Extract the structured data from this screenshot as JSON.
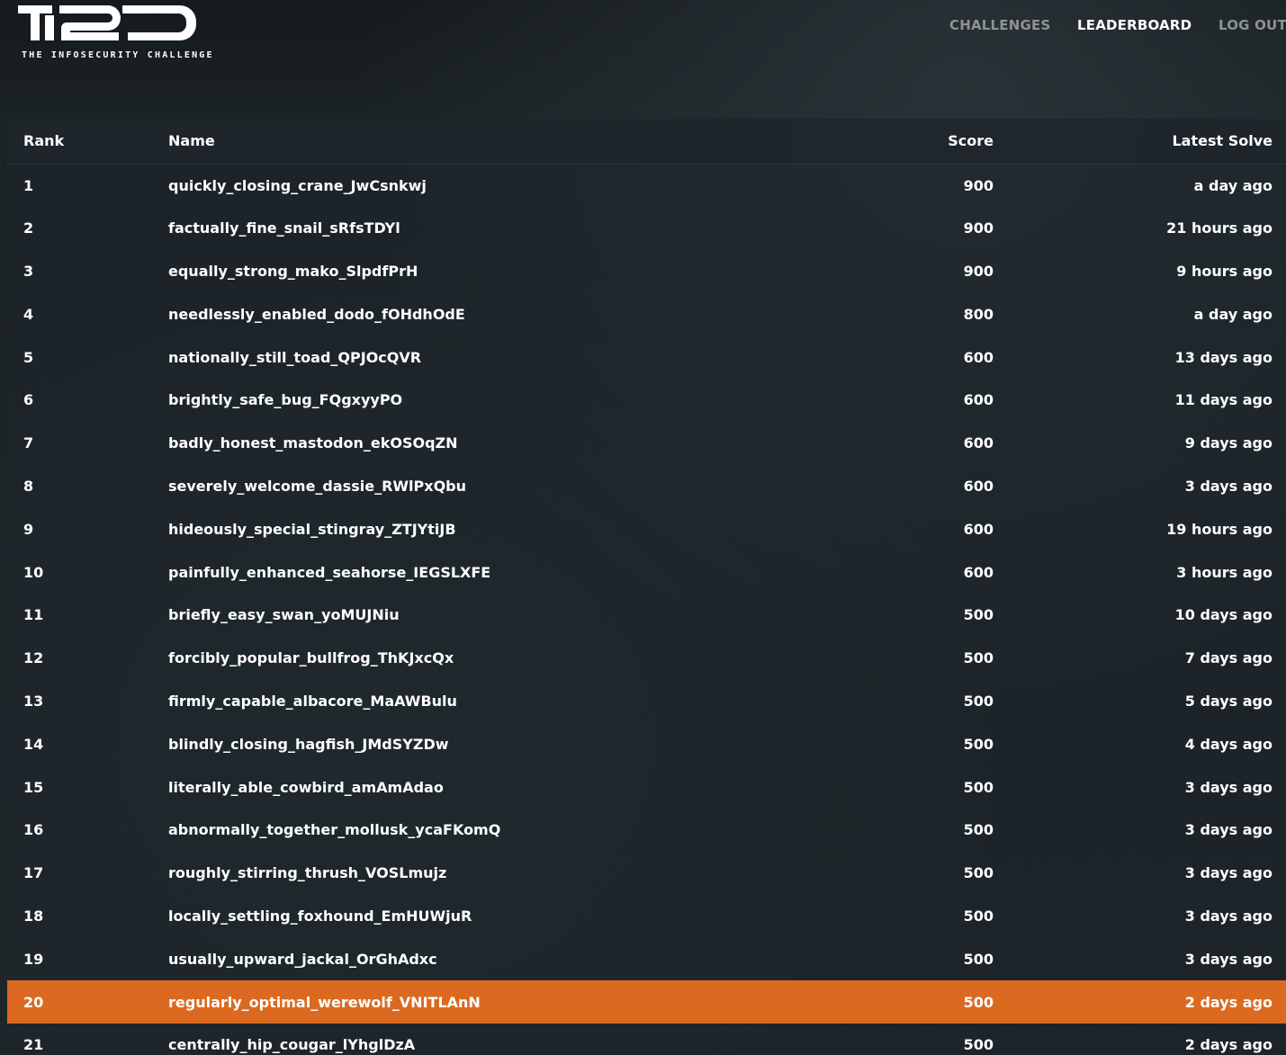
{
  "header": {
    "logo_text": "TI2D",
    "tagline": "THE INFOSECURITY CHALLENGE",
    "nav": {
      "challenges": "CHALLENGES",
      "leaderboard": "LEADERBOARD",
      "logout": "LOG OUT"
    },
    "active_nav": "leaderboard"
  },
  "colors": {
    "highlight_row": "#db6a20",
    "nav_inactive": "#8c9296",
    "nav_active": "#ffffff",
    "background": "#1d2428"
  },
  "leaderboard": {
    "columns": {
      "rank": "Rank",
      "name": "Name",
      "score": "Score",
      "latest_solve": "Latest Solve"
    },
    "highlighted_rank": "20",
    "rows": [
      {
        "rank": "1",
        "name": "quickly_closing_crane_JwCsnkwj",
        "score": "900",
        "latest_solve": "a day ago"
      },
      {
        "rank": "2",
        "name": "factually_fine_snail_sRfsTDYl",
        "score": "900",
        "latest_solve": "21 hours ago"
      },
      {
        "rank": "3",
        "name": "equally_strong_mako_SlpdfPrH",
        "score": "900",
        "latest_solve": "9 hours ago"
      },
      {
        "rank": "4",
        "name": "needlessly_enabled_dodo_fOHdhOdE",
        "score": "800",
        "latest_solve": "a day ago"
      },
      {
        "rank": "5",
        "name": "nationally_still_toad_QPJOcQVR",
        "score": "600",
        "latest_solve": "13 days ago"
      },
      {
        "rank": "6",
        "name": "brightly_safe_bug_FQgxyyPO",
        "score": "600",
        "latest_solve": "11 days ago"
      },
      {
        "rank": "7",
        "name": "badly_honest_mastodon_ekOSOqZN",
        "score": "600",
        "latest_solve": "9 days ago"
      },
      {
        "rank": "8",
        "name": "severely_welcome_dassie_RWlPxQbu",
        "score": "600",
        "latest_solve": "3 days ago"
      },
      {
        "rank": "9",
        "name": "hideously_special_stingray_ZTJYtiJB",
        "score": "600",
        "latest_solve": "19 hours ago"
      },
      {
        "rank": "10",
        "name": "painfully_enhanced_seahorse_IEGSLXFE",
        "score": "600",
        "latest_solve": "3 hours ago"
      },
      {
        "rank": "11",
        "name": "briefly_easy_swan_yoMUJNiu",
        "score": "500",
        "latest_solve": "10 days ago"
      },
      {
        "rank": "12",
        "name": "forcibly_popular_bullfrog_ThKJxcQx",
        "score": "500",
        "latest_solve": "7 days ago"
      },
      {
        "rank": "13",
        "name": "firmly_capable_albacore_MaAWBulu",
        "score": "500",
        "latest_solve": "5 days ago"
      },
      {
        "rank": "14",
        "name": "blindly_closing_hagfish_JMdSYZDw",
        "score": "500",
        "latest_solve": "4 days ago"
      },
      {
        "rank": "15",
        "name": "literally_able_cowbird_amAmAdao",
        "score": "500",
        "latest_solve": "3 days ago"
      },
      {
        "rank": "16",
        "name": "abnormally_together_mollusk_ycaFKomQ",
        "score": "500",
        "latest_solve": "3 days ago"
      },
      {
        "rank": "17",
        "name": "roughly_stirring_thrush_VOSLmujz",
        "score": "500",
        "latest_solve": "3 days ago"
      },
      {
        "rank": "18",
        "name": "locally_settling_foxhound_EmHUWjuR",
        "score": "500",
        "latest_solve": "3 days ago"
      },
      {
        "rank": "19",
        "name": "usually_upward_jackal_OrGhAdxc",
        "score": "500",
        "latest_solve": "3 days ago"
      },
      {
        "rank": "20",
        "name": "regularly_optimal_werewolf_VNITLAnN",
        "score": "500",
        "latest_solve": "2 days ago"
      },
      {
        "rank": "21",
        "name": "centrally_hip_cougar_lYhglDzA",
        "score": "500",
        "latest_solve": "2 days ago"
      }
    ]
  }
}
